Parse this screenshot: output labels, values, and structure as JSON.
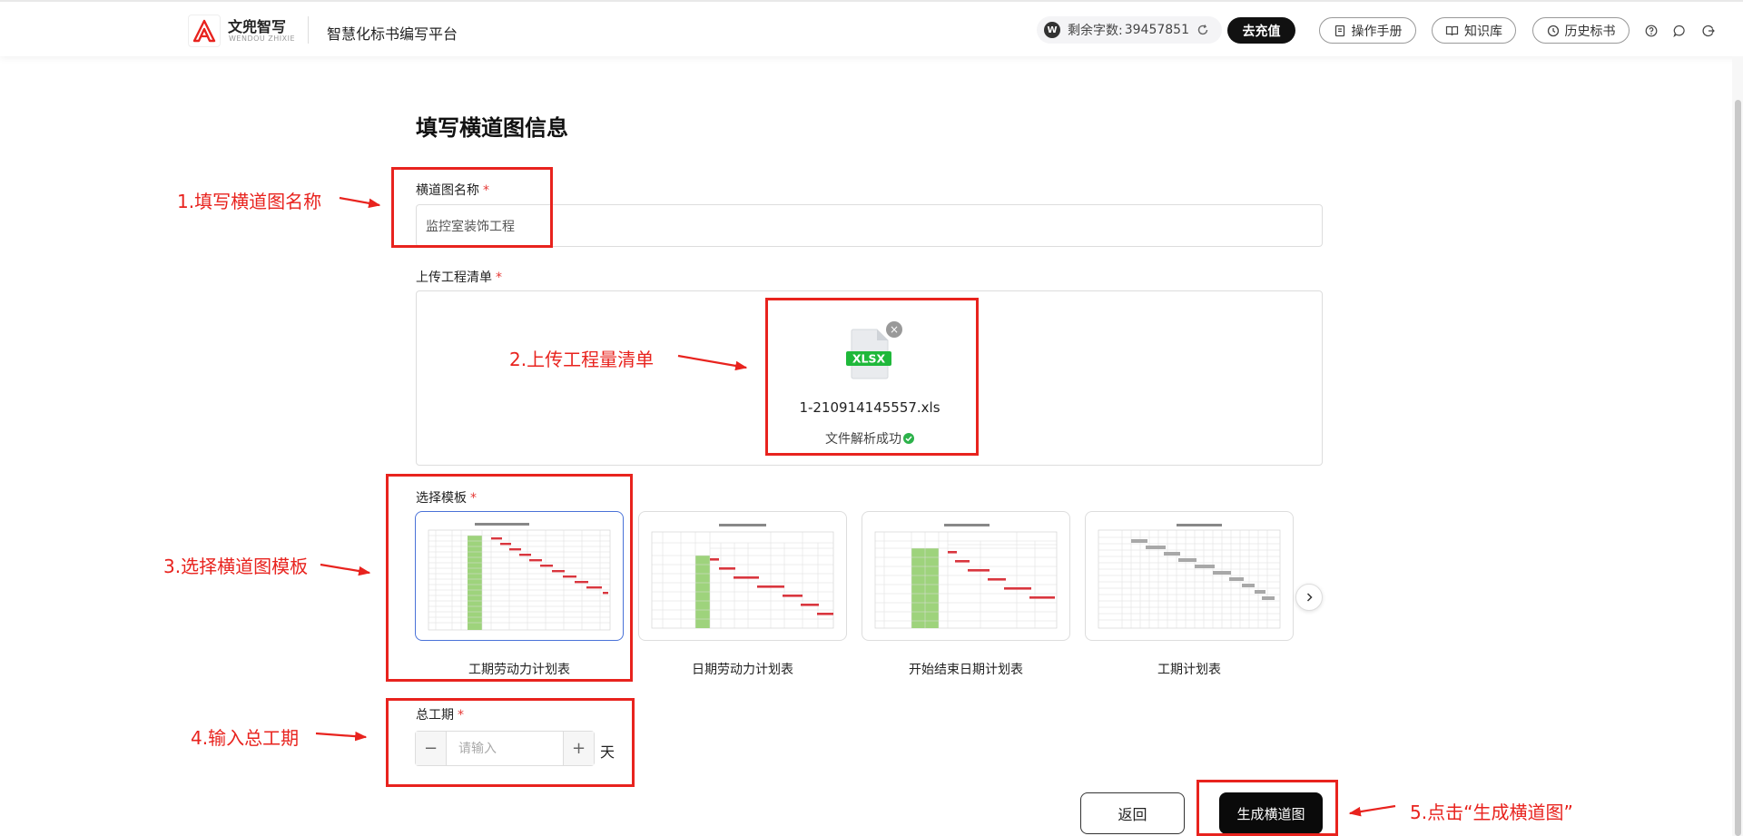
{
  "header": {
    "brand_name": "文兜智写",
    "brand_en": "WENDOU ZHIXIE",
    "platform_title": "智慧化标书编写平台",
    "quota_label": "剩余字数:",
    "quota_value": "39457851",
    "w_badge": "W",
    "recharge_label": "去充值",
    "manual_label": "操作手册",
    "knowledge_label": "知识库",
    "history_label": "历史标书"
  },
  "form": {
    "title": "填写横道图信息",
    "name_label": "横道图名称",
    "name_value": "监控室装饰工程",
    "upload_label": "上传工程清单",
    "file_ext": "XLSX",
    "file_name": "1-210914145557.xls",
    "file_status": "文件解析成功",
    "template_label": "选择模板",
    "templates": [
      {
        "label": "工期劳动力计划表"
      },
      {
        "label": "日期劳动力计划表"
      },
      {
        "label": "开始结束日期计划表"
      },
      {
        "label": "工期计划表"
      }
    ],
    "duration_label": "总工期",
    "duration_placeholder": "请输入",
    "duration_minus": "−",
    "duration_plus": "+",
    "duration_unit": "天",
    "required_mark": "*",
    "back_label": "返回",
    "generate_label": "生成横道图"
  },
  "annotations": {
    "step1": "1.填写横道图名称",
    "step2": "2.上传工程量清单",
    "step3": "3.选择横道图模板",
    "step4": "4.输入总工期",
    "step5": "5.点击“生成横道图”"
  },
  "colors": {
    "annotation_red": "#e8231e",
    "primary_black": "#0a0a0a",
    "selected_blue": "#4a72d8",
    "xlsx_green": "#1fb83a",
    "gantt_red": "#d9363e",
    "gantt_gray": "#a8a8a8",
    "gantt_green": "#9ed37c"
  }
}
